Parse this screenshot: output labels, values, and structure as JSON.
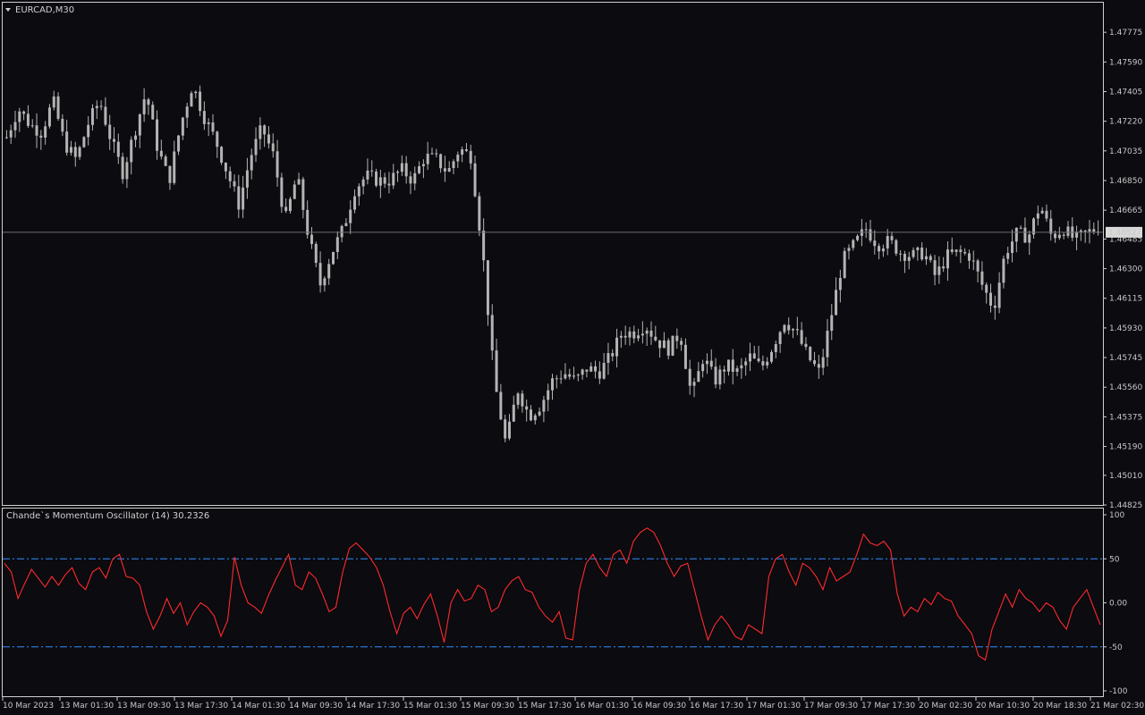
{
  "symbol_title": "EURCAD,M30",
  "indicator": {
    "name": "Chande`s Momentum Oscillator (14)",
    "value": "30.2326"
  },
  "current_price_label": "1.46527",
  "colors": {
    "background": "#0b0b10",
    "candle": "#b4b4b4",
    "cmo_line": "#ff2a2a",
    "levels": "#2f8fff",
    "axis": "#c8c8c8",
    "price_line": "#6e6e6e"
  },
  "chart_data": [
    {
      "type": "candlestick",
      "title": "EURCAD,M30",
      "ylim": [
        1.44825,
        1.4796
      ],
      "price_ticks": [
        "1.47775",
        "1.47590",
        "1.47405",
        "1.47220",
        "1.47035",
        "1.46850",
        "1.46665",
        "1.46485",
        "1.46300",
        "1.46115",
        "1.45930",
        "1.45745",
        "1.45560",
        "1.45375",
        "1.45190",
        "1.45010",
        "1.44825"
      ],
      "current_price": 1.46527,
      "x_ticks": [
        "10 Mar 2023",
        "13 Mar 01:30",
        "13 Mar 09:30",
        "13 Mar 17:30",
        "14 Mar 01:30",
        "14 Mar 09:30",
        "14 Mar 17:30",
        "15 Mar 01:30",
        "15 Mar 09:30",
        "15 Mar 17:30",
        "16 Mar 01:30",
        "16 Mar 09:30",
        "16 Mar 17:30",
        "17 Mar 01:30",
        "17 Mar 09:30",
        "17 Mar 17:30",
        "20 Mar 02:30",
        "20 Mar 10:30",
        "20 Mar 18:30",
        "21 Mar 02:30"
      ],
      "close_path": [
        1.4712,
        1.473,
        1.472,
        1.4715,
        1.4735,
        1.4708,
        1.4698,
        1.472,
        1.4735,
        1.471,
        1.469,
        1.4715,
        1.474,
        1.4705,
        1.4685,
        1.472,
        1.4745,
        1.4725,
        1.471,
        1.469,
        1.467,
        1.47,
        1.4718,
        1.47,
        1.466,
        1.4688,
        1.465,
        1.462,
        1.464,
        1.4655,
        1.468,
        1.4688,
        1.4685,
        1.4685,
        1.4692,
        1.4685,
        1.47,
        1.4698,
        1.469,
        1.4705,
        1.47,
        1.464,
        1.456,
        1.452,
        1.4555,
        1.4538,
        1.4545,
        1.456,
        1.4565,
        1.456,
        1.4568,
        1.4565,
        1.4575,
        1.459,
        1.459,
        1.4595,
        1.4585,
        1.458,
        1.459,
        1.455,
        1.4575,
        1.456,
        1.457,
        1.4565,
        1.4575,
        1.4568,
        1.4582,
        1.4598,
        1.459,
        1.4575,
        1.4565,
        1.46,
        1.4635,
        1.4645,
        1.4655,
        1.4645,
        1.4647,
        1.464,
        1.4638,
        1.464,
        1.4625,
        1.4638,
        1.464,
        1.4638,
        1.462,
        1.4605,
        1.464,
        1.4652,
        1.465,
        1.467,
        1.465,
        1.4655,
        1.4648,
        1.4652,
        1.4656
      ],
      "candles": 255
    },
    {
      "type": "line",
      "title": "Chande`s Momentum Oscillator (14)",
      "ylim": [
        -100,
        100
      ],
      "y_ticks": [
        "100",
        "50",
        "0.00",
        "-50",
        "-100"
      ],
      "levels": [
        50,
        -50
      ],
      "series": [
        {
          "name": "Chande`s Momentum Oscillator (14)",
          "values": [
            45,
            35,
            5,
            22,
            38,
            28,
            18,
            30,
            20,
            32,
            40,
            22,
            15,
            35,
            40,
            28,
            50,
            55,
            30,
            28,
            20,
            -10,
            -30,
            -15,
            5,
            -12,
            0,
            -25,
            -10,
            0,
            -5,
            -15,
            -38,
            -20,
            52,
            20,
            0,
            -5,
            -12,
            8,
            25,
            40,
            55,
            20,
            15,
            35,
            28,
            10,
            -10,
            -5,
            35,
            62,
            68,
            60,
            52,
            40,
            20,
            -10,
            -35,
            -12,
            -5,
            -18,
            -2,
            10,
            -15,
            -45,
            0,
            15,
            2,
            5,
            20,
            15,
            -10,
            -5,
            15,
            25,
            30,
            15,
            12,
            -5,
            -15,
            -22,
            -10,
            -40,
            -42,
            15,
            45,
            55,
            40,
            30,
            55,
            60,
            45,
            70,
            80,
            85,
            80,
            65,
            45,
            30,
            42,
            45,
            15,
            -15,
            -42,
            -25,
            -15,
            -25,
            -38,
            -42,
            -25,
            -30,
            -35,
            30,
            50,
            55,
            35,
            20,
            45,
            40,
            30,
            15,
            40,
            25,
            30,
            35,
            55,
            78,
            68,
            65,
            70,
            60,
            10,
            -15,
            -5,
            -10,
            5,
            -2,
            12,
            5,
            2,
            -15,
            -25,
            -35,
            -60,
            -65,
            -30,
            -10,
            10,
            -5,
            15,
            5,
            0,
            -10,
            0,
            -5,
            -20,
            -30,
            -5,
            5,
            15,
            -5,
            -25
          ]
        }
      ]
    }
  ]
}
